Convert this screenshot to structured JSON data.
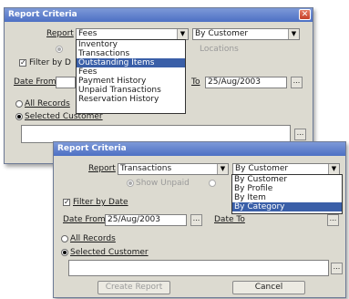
{
  "dialog_back": {
    "title": "Report Criteria",
    "report_label": "Report",
    "report_value": "Fees",
    "sort_value": "By Customer",
    "report_options": [
      "Inventory",
      "Transactions",
      "Outstanding Items",
      "Fees",
      "Payment History",
      "Unpaid Transactions",
      "Reservation History"
    ],
    "selected_option": "Outstanding Items",
    "filter_label": "Filter by D",
    "date_from_label": "Date From",
    "to_label": "To",
    "to_value": "25/Aug/2003",
    "all_records_label": "All Records",
    "selected_customer_label": "Selected Customer",
    "hidden_text": "Locations"
  },
  "dialog_front": {
    "title": "Report Criteria",
    "report_label": "Report",
    "report_value": "Transactions",
    "sort_value": "By Customer",
    "sort_options": [
      "By Customer",
      "By Profile",
      "By Item",
      "By Category"
    ],
    "selected_sort": "By Category",
    "summary_label": "Show Unpaid",
    "filter_label": "Filter by Date",
    "date_from_label": "Date From",
    "date_from_value": "25/Aug/2003",
    "date_to_label": "Date To",
    "all_records_label": "All Records",
    "selected_customer_label": "Selected Customer",
    "create_button": "Create Report",
    "cancel_button": "Cancel"
  },
  "colors": {
    "title_bar": "#4d70c4",
    "highlight": "#3a5fa8",
    "window_bg": "#dcdad0"
  }
}
